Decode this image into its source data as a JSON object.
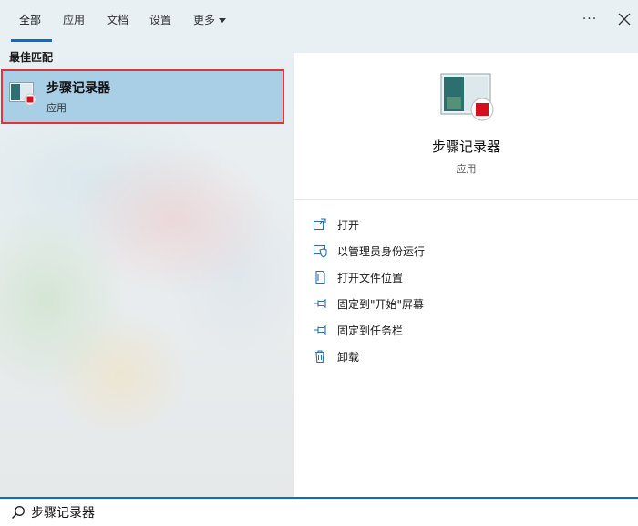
{
  "tabs": [
    {
      "label": "全部",
      "active": true
    },
    {
      "label": "应用",
      "active": false
    },
    {
      "label": "文档",
      "active": false
    },
    {
      "label": "设置",
      "active": false
    },
    {
      "label": "更多",
      "active": false
    }
  ],
  "header": {
    "more_options_icon": "ellipsis-icon",
    "close_icon": "close-icon"
  },
  "best_match": {
    "section_label": "最佳匹配",
    "title": "步骤记录器",
    "subtitle": "应用",
    "icon": "steps-recorder-icon"
  },
  "details": {
    "title": "步骤记录器",
    "subtitle": "应用",
    "actions": [
      {
        "label": "打开",
        "icon": "open-icon"
      },
      {
        "label": "以管理员身份运行",
        "icon": "run-as-admin-icon"
      },
      {
        "label": "打开文件位置",
        "icon": "file-location-icon"
      },
      {
        "label": "固定到\"开始\"屏幕",
        "icon": "pin-start-icon"
      },
      {
        "label": "固定到任务栏",
        "icon": "pin-taskbar-icon"
      },
      {
        "label": "卸载",
        "icon": "trash-icon"
      }
    ]
  },
  "search": {
    "value": "步骤记录器",
    "icon": "search-icon"
  },
  "colors": {
    "accent": "#0a6fc2",
    "selection": "#a9cfe7",
    "highlight_border": "#e0343c"
  }
}
